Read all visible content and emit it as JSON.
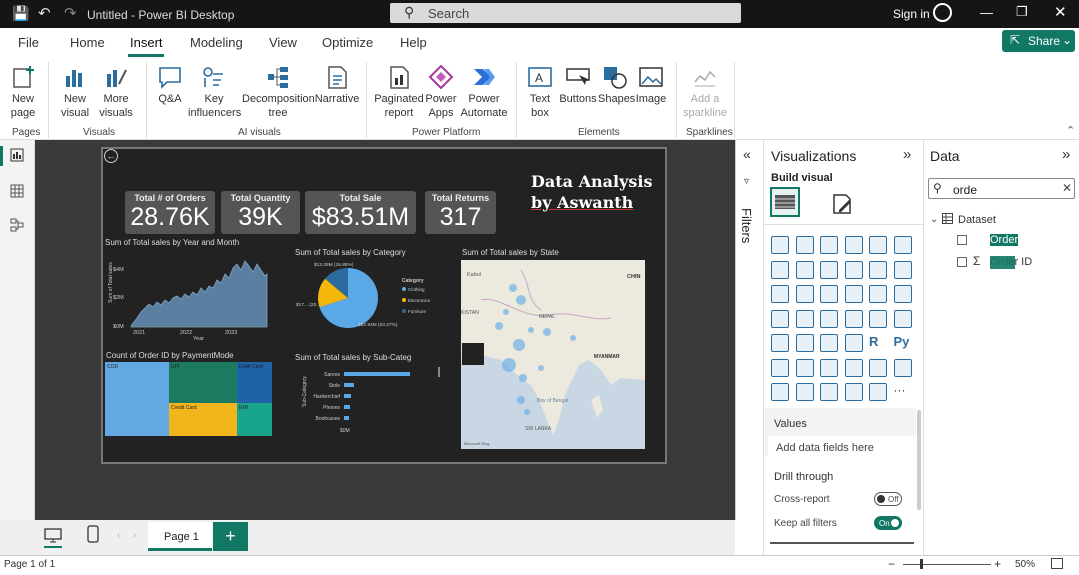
{
  "titlebar": {
    "title": "Untitled - Power BI Desktop",
    "search": "Search",
    "signin": "Sign in"
  },
  "menu": [
    "File",
    "Home",
    "Insert",
    "Modeling",
    "View",
    "Optimize",
    "Help"
  ],
  "share": "Share",
  "ribbon": {
    "new_page": "New page",
    "new_visual": "New visual",
    "more_visuals": "More visuals",
    "qa": "Q&A",
    "key_influencers": "Key influencers",
    "decomposition_tree": "Decomposition tree",
    "narrative": "Narrative",
    "paginated_report": "Paginated report",
    "power_apps": "Power Apps",
    "power_automate": "Power Automate",
    "text_box": "Text box",
    "buttons": "Buttons",
    "shapes": "Shapes",
    "image": "Image",
    "add_sparkline": "Add a sparkline",
    "groups": {
      "pages": "Pages",
      "visuals": "Visuals",
      "ai_visuals": "AI visuals",
      "power_platform": "Power Platform",
      "elements": "Elements",
      "sparklines": "Sparklines"
    }
  },
  "report": {
    "title_line1": "Data Analysis",
    "title_line2": "by Aswanth",
    "kpis": [
      {
        "label": "Total # of Orders",
        "value": "28.76K"
      },
      {
        "label": "Total Quantity",
        "value": "39K"
      },
      {
        "label": "Total Sale",
        "value": "$83.51M"
      },
      {
        "label": "Total Returns",
        "value": "317"
      }
    ],
    "area_title": "Sum of Total sales by Year and Month",
    "area_ylabel": "Sum of Total sales",
    "area_xlabel": "Year",
    "area_yticks": [
      "$4M",
      "$2M",
      "$0M"
    ],
    "area_xticks": [
      "2021",
      "2022",
      "2023"
    ],
    "pie_title": "Sum of Total sales by Category",
    "pie_legend_title": "Category",
    "pie_legend": [
      "Clothing",
      "Electronics",
      "Furniture"
    ],
    "pie_labels": [
      "$13.28M (15.88%)",
      "$17... (20...)",
      "$52.93M (63.27%)"
    ],
    "map_title": "Sum of Total sales by State",
    "map_places": [
      "Kabul",
      "CHIN",
      "KISTAN",
      "NEPAL",
      "MYANMAR",
      "Bay of Bengal",
      "SRI LANKA",
      "Microsoft Bing"
    ],
    "treemap_title": "Count of Order ID by PaymentMode",
    "treemap_labels": [
      "COD",
      "UPI",
      "Debit Card",
      "Credit Card",
      "EMI"
    ],
    "bar_title": "Sum of Total sales by Sub-Categ",
    "bar_ylabel": "Sub-Category",
    "bar_categories": [
      "Sarees",
      "Stole",
      "Hankerchief",
      "Phones",
      "Bookcases"
    ],
    "bar_xtick": "$0M"
  },
  "filters_label": "Filters",
  "viz": {
    "title": "Visualizations",
    "build": "Build visual",
    "values": "Values",
    "add_fields": "Add data fields here",
    "drill": "Drill through",
    "cross_report": "Cross-report",
    "cross_state": "Off",
    "keep_filters": "Keep all filters",
    "keep_state": "On"
  },
  "data": {
    "title": "Data",
    "search_value": "orde",
    "dataset": "Dataset",
    "fields": [
      "Order",
      "Order ID"
    ]
  },
  "pages": {
    "tab": "Page 1"
  },
  "status": {
    "page": "Page 1 of 1",
    "zoom": "50%"
  },
  "colors": {
    "accent": "#117865",
    "area": "#5b7fa0",
    "pie_blue": "#5aa9e6",
    "pie_yellow": "#f5b70a",
    "tm_blue": "#62a8e2",
    "tm_teal": "#1b7a5f",
    "tm_navy": "#1e62a8",
    "tm_yellow": "#f3b51c",
    "tm_green": "#19a58c"
  }
}
